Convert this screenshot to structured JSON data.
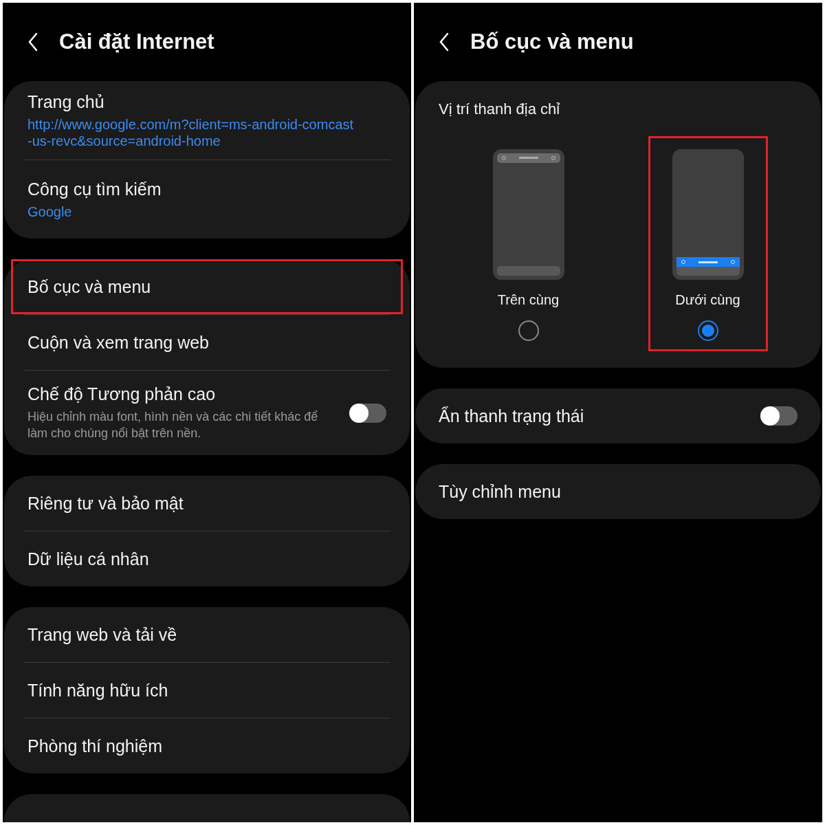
{
  "panels": [
    {
      "title": "Cài đặt Internet",
      "groups": [
        {
          "items": [
            {
              "kind": "value",
              "label": "Trang chủ",
              "value": "http://www.google.com/m?client=ms-android-comcast-us-revc&source=android-home",
              "highlighted": false
            },
            {
              "kind": "value",
              "label": "Công cụ tìm kiếm",
              "value": "Google",
              "highlighted": false
            }
          ]
        },
        {
          "items": [
            {
              "kind": "plain",
              "label": "Bố cục và menu",
              "highlighted": true
            },
            {
              "kind": "plain",
              "label": "Cuộn và xem trang web",
              "highlighted": false
            },
            {
              "kind": "toggle",
              "label": "Chế độ Tương phản cao",
              "description": "Hiệu chỉnh màu font, hình nền và các chi tiết khác để làm cho chúng nổi bật trên nền.",
              "on": false,
              "highlighted": false
            }
          ]
        },
        {
          "items": [
            {
              "kind": "plain",
              "label": "Riêng tư và bảo mật",
              "highlighted": false
            },
            {
              "kind": "plain",
              "label": "Dữ liệu cá nhân",
              "highlighted": false
            }
          ]
        },
        {
          "items": [
            {
              "kind": "plain",
              "label": "Trang web và tải về",
              "highlighted": false
            },
            {
              "kind": "plain",
              "label": "Tính năng hữu ích",
              "highlighted": false
            },
            {
              "kind": "plain",
              "label": "Phòng thí nghiệm",
              "highlighted": false
            }
          ]
        },
        {
          "kind": "peek"
        }
      ]
    },
    {
      "title": "Bố cục và menu",
      "groups": [
        {
          "items": [
            {
              "kind": "position",
              "label": "Vị trí thanh địa chỉ",
              "options": [
                {
                  "label": "Trên cùng",
                  "kind": "top_bar",
                  "selected": false,
                  "highlighted": false
                },
                {
                  "label": "Dưới cùng",
                  "kind": "bottom_bar",
                  "selected": true,
                  "highlighted": true
                }
              ]
            }
          ]
        },
        {
          "items": [
            {
              "kind": "toggle",
              "label": "Ẩn thanh trạng thái",
              "on": false,
              "highlighted": false
            }
          ]
        },
        {
          "items": [
            {
              "kind": "plain",
              "label": "Tùy chỉnh menu",
              "highlighted": false
            }
          ]
        }
      ]
    }
  ]
}
